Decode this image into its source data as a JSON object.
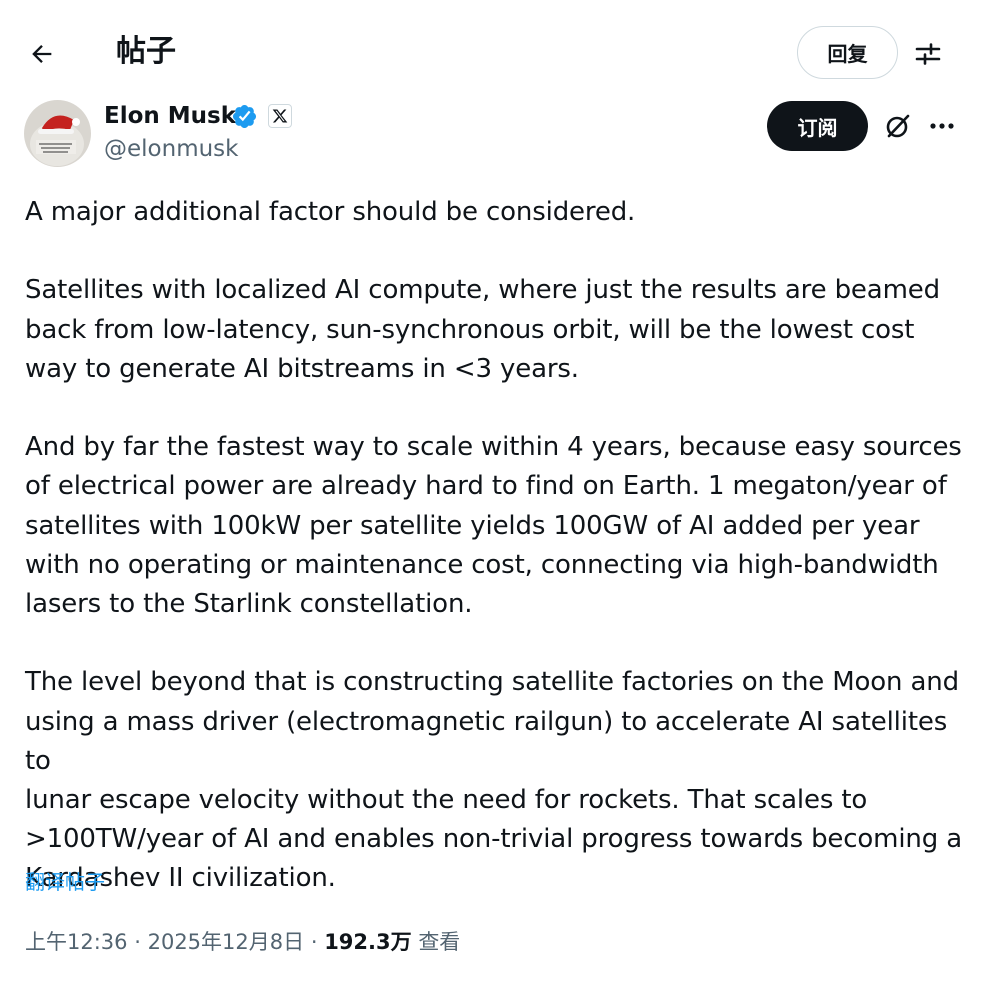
{
  "header": {
    "back_icon": "arrow-left-icon",
    "title": "帖子",
    "reply_label": "回复",
    "filter_icon": "sliders-icon"
  },
  "author": {
    "name": "Elon Musk",
    "handle": "@elonmusk",
    "verified_icon": "verified-badge-icon",
    "affiliate_icon": "x-logo-icon",
    "verified_color": "#1d9bf0"
  },
  "actions": {
    "subscribe_label": "订阅",
    "grok_icon": "grok-icon",
    "more_icon": "more-dots-icon"
  },
  "tweet": {
    "paragraphs": [
      "A major additional factor should be considered.",
      "Satellites with localized AI compute, where just the results are beamed\nback from low-latency, sun-synchronous orbit, will be the lowest cost\nway to generate AI bitstreams in <3 years.",
      "And by far the fastest way to scale within 4 years, because easy sources\nof electrical power are already hard to find on Earth. 1 megaton/year of\nsatellites with 100kW per satellite yields 100GW of AI added per year\nwith no operating or maintenance cost, connecting via high-bandwidth\nlasers to the Starlink constellation.",
      "The level beyond that is constructing satellite factories on the Moon and\nusing a mass driver (electromagnetic railgun) to accelerate AI satellites to\nlunar escape velocity without the need for rockets. That scales to\n>100TW/year of AI and enables non-trivial progress towards becoming a\nKardashev II civilization."
    ],
    "translate_label": "翻译帖子"
  },
  "meta": {
    "time": "上午12:36",
    "separator": "·",
    "date": "2025年12月8日",
    "views_count": "192.3万",
    "views_label": "查看"
  },
  "colors": {
    "text": "#0f1419",
    "secondary_text": "#536471",
    "link": "#1d9bf0",
    "border": "#cfd9de",
    "subscribe_bg": "#0f1419"
  }
}
